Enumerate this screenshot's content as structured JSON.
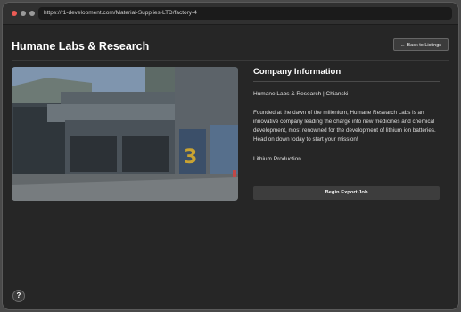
{
  "browser": {
    "url": "https://r1-development.com/Material-Supplies-LTD/factory-4"
  },
  "header": {
    "title": "Humane Labs & Research",
    "back_label": "Back to Listings",
    "back_icon": "arrow-left-icon"
  },
  "hero": {
    "alt_semantic": "factory-photo"
  },
  "company": {
    "section_title": "Company Information",
    "subline": "Humane Labs & Research | Chianski",
    "description": "Founded at the dawn of the millenium, Humane Research Labs is an innovative company leading the charge into new medicines and chemical development, most renowned for the development of lithium ion batteries. Head on down today to start your mission!",
    "product": "Lithium Production",
    "export_label": "Begin Export Job"
  },
  "help": {
    "label": "?"
  },
  "colors": {
    "close_dot": "#ec5b55",
    "background": "#262626",
    "button": "#3d3d3d"
  }
}
